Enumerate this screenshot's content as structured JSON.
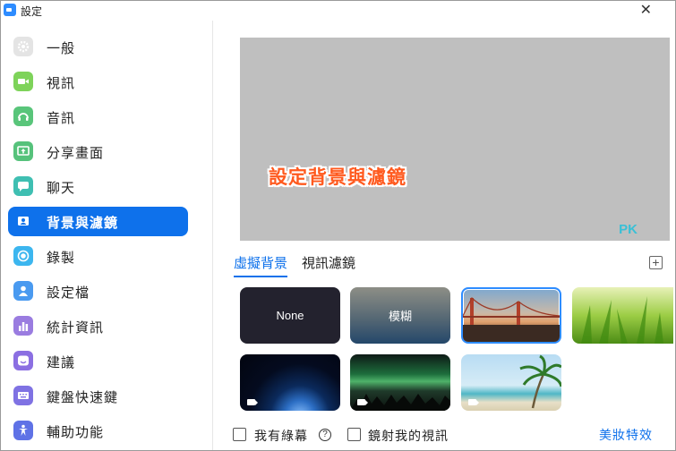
{
  "window": {
    "title": "設定",
    "close_glyph": "✕"
  },
  "sidebar": {
    "items": [
      {
        "label": "一般",
        "icon": "gear-icon",
        "color": "#e4e4e4"
      },
      {
        "label": "視訊",
        "icon": "video-camera-icon",
        "color": "#7ed35a"
      },
      {
        "label": "音訊",
        "icon": "headphones-icon",
        "color": "#59c57a"
      },
      {
        "label": "分享畫面",
        "icon": "share-screen-icon",
        "color": "#56c27b"
      },
      {
        "label": "聊天",
        "icon": "chat-bubble-icon",
        "color": "#3fbfb2"
      },
      {
        "label": "背景與濾鏡",
        "icon": "background-portrait-icon",
        "color": "#0e71eb",
        "active": true
      },
      {
        "label": "錄製",
        "icon": "record-icon",
        "color": "#3cb6ef"
      },
      {
        "label": "設定檔",
        "icon": "profile-icon",
        "color": "#4a9af0"
      },
      {
        "label": "統計資訊",
        "icon": "statistics-icon",
        "color": "#9a7ce0"
      },
      {
        "label": "建議",
        "icon": "feedback-smile-icon",
        "color": "#8b6fe2"
      },
      {
        "label": "鍵盤快速鍵",
        "icon": "keyboard-icon",
        "color": "#7f72e3"
      },
      {
        "label": "輔助功能",
        "icon": "accessibility-icon",
        "color": "#5f72e6"
      }
    ]
  },
  "preview": {
    "overlay_text": "設定背景與濾鏡",
    "watermark": "PK"
  },
  "tabs": [
    {
      "label": "虛擬背景",
      "active": true
    },
    {
      "label": "視訊濾鏡",
      "active": false
    }
  ],
  "add_button": {
    "glyph": "+"
  },
  "backgrounds": [
    {
      "label": "None",
      "type": "none"
    },
    {
      "label": "模糊",
      "type": "blur"
    },
    {
      "label": "",
      "type": "image",
      "subject": "golden-gate-bridge",
      "selected": true
    },
    {
      "label": "",
      "type": "image",
      "subject": "green-grass"
    },
    {
      "label": "",
      "type": "video",
      "subject": "earth-from-space"
    },
    {
      "label": "",
      "type": "video",
      "subject": "aurora"
    },
    {
      "label": "",
      "type": "video",
      "subject": "beach-palm"
    }
  ],
  "options": {
    "green_screen_label": "我有綠幕",
    "help_glyph": "?",
    "mirror_label": "鏡射我的視訊",
    "beauty_link": "美妝特效"
  },
  "colors": {
    "accent": "#0e71eb",
    "overlay_text": "#ff5a1f"
  }
}
